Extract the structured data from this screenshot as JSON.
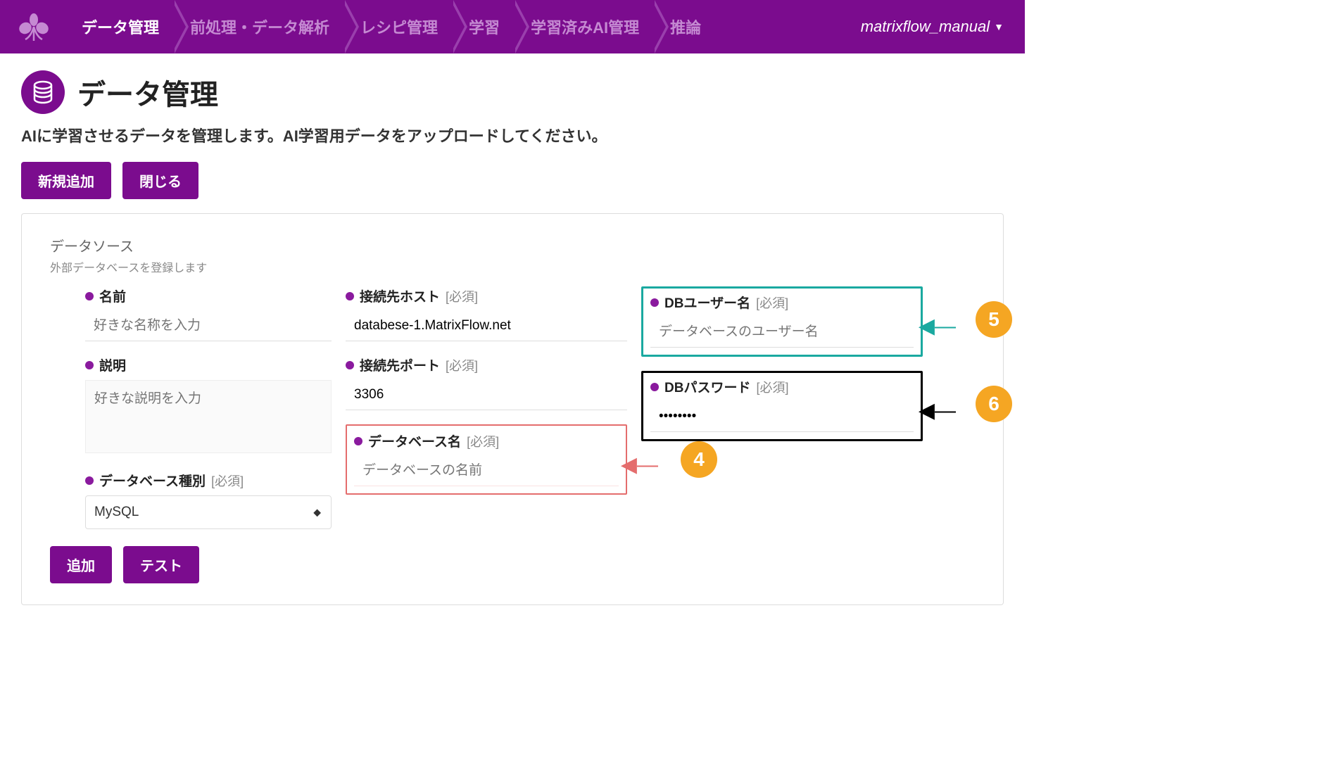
{
  "nav": {
    "items": [
      "データ管理",
      "前処理・データ解析",
      "レシピ管理",
      "学習",
      "学習済みAI管理",
      "推論"
    ],
    "active_index": 0,
    "user": "matrixflow_manual"
  },
  "page": {
    "title": "データ管理",
    "description": "AIに学習させるデータを管理します。AI学習用データをアップロードしてください。",
    "buttons": {
      "add_new": "新規追加",
      "close": "閉じる"
    }
  },
  "datasource": {
    "section_title": "データソース",
    "section_sub": "外部データベースを登録します",
    "fields": {
      "name": {
        "label": "名前",
        "placeholder": "好きな名称を入力",
        "value": ""
      },
      "description": {
        "label": "説明",
        "placeholder": "好きな説明を入力",
        "value": ""
      },
      "db_type": {
        "label": "データベース種別",
        "required": "[必須]",
        "value": "MySQL"
      },
      "host": {
        "label": "接続先ホスト",
        "required": "[必須]",
        "value": "databese-1.MatrixFlow.net"
      },
      "port": {
        "label": "接続先ポート",
        "required": "[必須]",
        "value": "3306"
      },
      "db_name": {
        "label": "データベース名",
        "required": "[必須]",
        "placeholder": "データベースの名前",
        "value": ""
      },
      "db_user": {
        "label": "DBユーザー名",
        "required": "[必須]",
        "placeholder": "データベースのユーザー名",
        "value": ""
      },
      "db_password": {
        "label": "DBパスワード",
        "required": "[必須]",
        "value": "••••••••"
      }
    },
    "buttons": {
      "add": "追加",
      "test": "テスト"
    }
  },
  "annotations": {
    "b4": "4",
    "b5": "5",
    "b6": "6"
  }
}
